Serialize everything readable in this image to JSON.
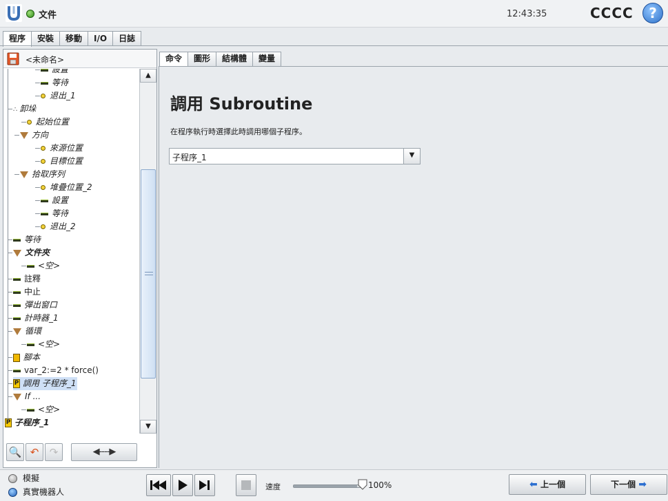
{
  "header": {
    "doc_title": "文件",
    "clock": "12:43:35",
    "robot_name": "CCCC",
    "help_label": "?"
  },
  "main_tabs": [
    {
      "label": "程序",
      "active": true
    },
    {
      "label": "安裝",
      "active": false
    },
    {
      "label": "移動",
      "active": false
    },
    {
      "label": "I/O",
      "active": false
    },
    {
      "label": "日誌",
      "active": false
    }
  ],
  "left_panel": {
    "file_name": "<未命名>",
    "tree": [
      {
        "label": "設置",
        "icon": "bar-icon",
        "indent": 4,
        "style": ""
      },
      {
        "label": "等待",
        "icon": "bar-icon",
        "indent": 4,
        "style": ""
      },
      {
        "label": "退出_1",
        "icon": "waypoint-icon",
        "indent": 4,
        "style": ""
      },
      {
        "label": "卸垛",
        "icon": "pallet-icon",
        "indent": 0,
        "style": ""
      },
      {
        "label": "起始位置",
        "icon": "waypoint-icon",
        "indent": 2,
        "style": ""
      },
      {
        "label": "方向",
        "icon": "folder-triangle-icon",
        "indent": 1,
        "style": ""
      },
      {
        "label": "來源位置",
        "icon": "waypoint-icon",
        "indent": 4,
        "style": ""
      },
      {
        "label": "目標位置",
        "icon": "waypoint-icon",
        "indent": 4,
        "style": ""
      },
      {
        "label": "拾取序列",
        "icon": "folder-triangle-icon",
        "indent": 1,
        "style": ""
      },
      {
        "label": "堆疊位置_2",
        "icon": "waypoint-icon",
        "indent": 4,
        "style": ""
      },
      {
        "label": "設置",
        "icon": "bar-icon",
        "indent": 4,
        "style": ""
      },
      {
        "label": "等待",
        "icon": "bar-icon",
        "indent": 4,
        "style": ""
      },
      {
        "label": "退出_2",
        "icon": "waypoint-icon",
        "indent": 4,
        "style": ""
      },
      {
        "label": "等待",
        "icon": "bar-icon",
        "indent": 0,
        "style": ""
      },
      {
        "label": "文件夾",
        "icon": "folder-triangle-icon",
        "indent": 0,
        "style": "bold"
      },
      {
        "label": "<空>",
        "icon": "bar-icon",
        "indent": 2,
        "style": ""
      },
      {
        "label": "註釋",
        "icon": "bar-icon",
        "indent": 0,
        "style": "plain"
      },
      {
        "label": "中止",
        "icon": "bar-icon",
        "indent": 0,
        "style": "plain"
      },
      {
        "label": "彈出窗口",
        "icon": "bar-icon",
        "indent": 0,
        "style": ""
      },
      {
        "label": "計時器_1",
        "icon": "bar-icon",
        "indent": 0,
        "style": ""
      },
      {
        "label": "循環",
        "icon": "folder-triangle-icon",
        "indent": 0,
        "style": ""
      },
      {
        "label": "<空>",
        "icon": "bar-icon",
        "indent": 2,
        "style": ""
      },
      {
        "label": "腳本",
        "icon": "script-icon",
        "indent": 0,
        "style": ""
      },
      {
        "label": "var_2:=2 * force()",
        "icon": "bar-icon",
        "indent": 0,
        "style": "plain"
      },
      {
        "label": "調用 子程序_1",
        "icon": "call-icon",
        "indent": 0,
        "style": "sel"
      },
      {
        "label": "If ...",
        "icon": "folder-triangle-icon",
        "indent": 0,
        "style": ""
      },
      {
        "label": "<空>",
        "icon": "bar-icon",
        "indent": 2,
        "style": ""
      },
      {
        "label": "子程序_1",
        "icon": "call-icon",
        "indent": -1,
        "style": "bold"
      }
    ],
    "tool_buttons": {
      "search": "🔍",
      "undo": "↶",
      "redo": "↷",
      "move": "◀----▶"
    }
  },
  "sub_tabs": [
    {
      "label": "命令",
      "active": true
    },
    {
      "label": "圖形",
      "active": false
    },
    {
      "label": "結構體",
      "active": false
    },
    {
      "label": "變量",
      "active": false
    }
  ],
  "command": {
    "heading": "調用 Subroutine",
    "description": "在程序執行時選擇此時調用哪個子程序。",
    "selected_subroutine": "子程序_1"
  },
  "bottom": {
    "mode_sim_label": "模擬",
    "mode_real_label": "真實機器人",
    "speed_label": "速度",
    "speed_value": "100%",
    "speed_fraction": 1.0,
    "prev_label": "上一個",
    "next_label": "下一個"
  },
  "colors": {
    "accent": "#2c6fd0",
    "selection": "#cfe0f6",
    "status_ok": "#2f8a18"
  }
}
